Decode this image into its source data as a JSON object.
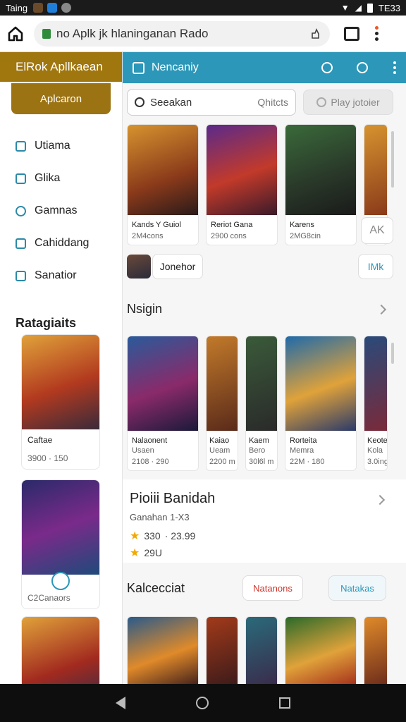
{
  "status": {
    "carrier": "Taing",
    "time": "TE33"
  },
  "browser": {
    "url": "no Aplk jk hlaninganan Rado"
  },
  "sidebar": {
    "brand": "ElRok Apllkaean",
    "tagline": "Aplcaron",
    "items": [
      {
        "label": "Utiama"
      },
      {
        "label": "Glika"
      },
      {
        "label": "Gamnas"
      },
      {
        "label": "Cahiddang"
      },
      {
        "label": "Sanatior"
      }
    ],
    "categories_title": "Ratagiaits",
    "cards": [
      {
        "title": "Caftae",
        "sub": "3900 · 150"
      },
      {
        "title": "",
        "sub": "C2Canaors"
      },
      {
        "title": "",
        "sub": ""
      }
    ]
  },
  "appbar": {
    "title": "Nencaniy"
  },
  "search": {
    "placeholder": "Seeakan",
    "category": "Qhitcts",
    "play_label": "Play jotoier"
  },
  "row1": [
    {
      "name": "Kands Y Guiol",
      "sub": "2M4cons"
    },
    {
      "name": "Reriot Gana",
      "sub": "2900 cons"
    },
    {
      "name": "Karens",
      "sub": "2MG8cin"
    },
    {
      "name": "",
      "sub": ""
    }
  ],
  "pill_ak": "AK",
  "chip_label": "Jonehor",
  "mk_label": "IMk",
  "section1": {
    "title": "Nsigin"
  },
  "row2": [
    {
      "name": "Nalaonent",
      "name2": "Usaen",
      "sub": "2108 · 290"
    },
    {
      "name": "Kaiao",
      "name2": "Ueam",
      "sub": "2200 m"
    },
    {
      "name": "Kaem",
      "name2": "Bero",
      "sub": "30l6l m"
    },
    {
      "name": "Rorteita",
      "name2": "Memra",
      "sub": "22M · 180"
    },
    {
      "name": "Keote",
      "name2": "Kola",
      "sub": "3.0ing"
    }
  ],
  "featured": {
    "title": "Pioiii Banidah",
    "subtitle": "Ganahan 1-X3",
    "rating1": "330",
    "rating1b": "· 23.99",
    "rating2": "29U"
  },
  "section2": {
    "title": "Kalcecciat",
    "btn1": "Natanons",
    "btn2": "Natakas"
  },
  "colors": {
    "appbar": "#2c97b8",
    "brand": "#a0760f",
    "accent_red": "#d0322a"
  }
}
